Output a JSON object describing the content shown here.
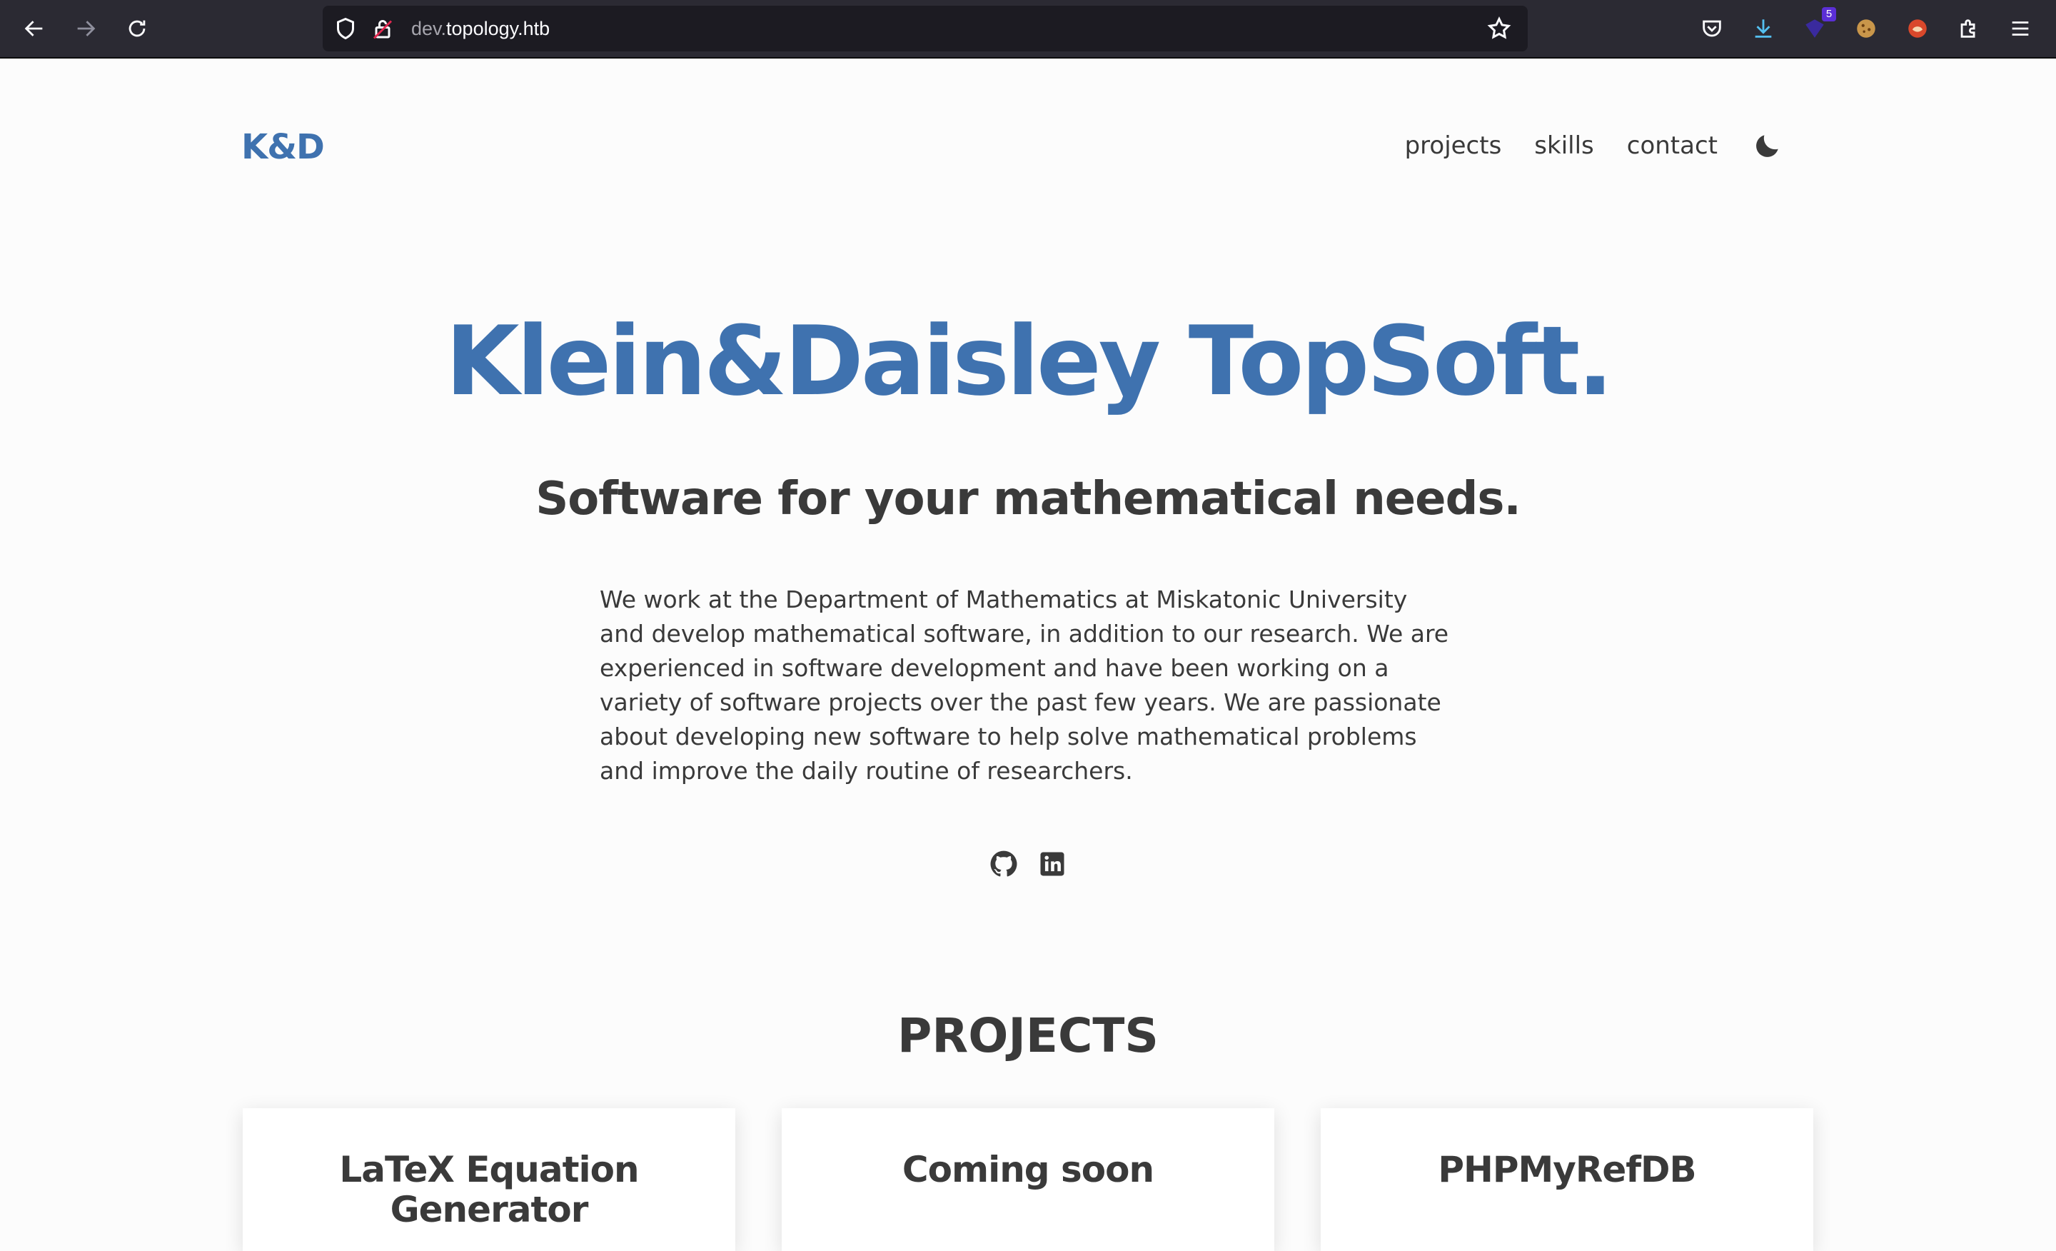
{
  "browser": {
    "url_dim": "dev.",
    "url_main": "topology.htb",
    "extension_badge": "5"
  },
  "site": {
    "logo": "K&D",
    "nav": [
      "projects",
      "skills",
      "contact"
    ],
    "hero": {
      "title": "Klein&Daisley TopSoft.",
      "subtitle": "Software for your mathematical needs.",
      "description": "We work at the Department of Mathematics at Miskatonic University and develop mathematical software, in addition to our research. We are experienced in software development and have been working on a variety of software projects over the past few years. We are passionate about developing new software to help solve mathematical problems and improve the daily routine of researchers."
    },
    "socials": [
      "github-icon",
      "linkedin-icon"
    ],
    "projects_heading": "PROJECTS",
    "projects": [
      {
        "title": "LaTeX Equation Generator"
      },
      {
        "title": "Coming soon"
      },
      {
        "title": "PHPMyRefDB"
      }
    ],
    "colors": {
      "accent": "#3f72af",
      "text": "#3a3a3a",
      "background": "#fcfcfc"
    }
  }
}
